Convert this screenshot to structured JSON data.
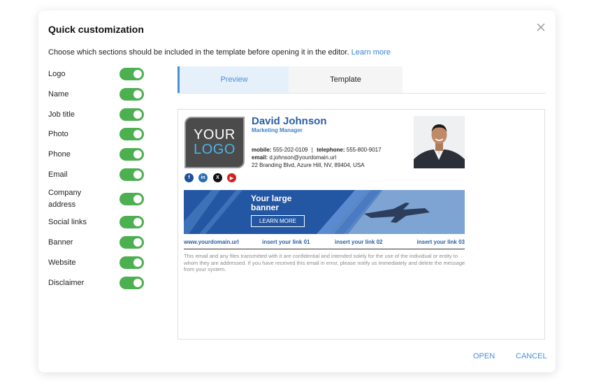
{
  "dialog": {
    "title": "Quick customization",
    "intro_text": "Choose which sections should be included in the template before opening it in the editor.",
    "learn_more": "Learn more"
  },
  "options": [
    {
      "label": "Logo",
      "enabled": true
    },
    {
      "label": "Name",
      "enabled": true
    },
    {
      "label": "Job title",
      "enabled": true
    },
    {
      "label": "Photo",
      "enabled": true
    },
    {
      "label": "Phone",
      "enabled": true
    },
    {
      "label": "Email",
      "enabled": true
    },
    {
      "label": "Company address",
      "enabled": true
    },
    {
      "label": "Social links",
      "enabled": true
    },
    {
      "label": "Banner",
      "enabled": true
    },
    {
      "label": "Website",
      "enabled": true
    },
    {
      "label": "Disclaimer",
      "enabled": true
    }
  ],
  "tabs": {
    "preview": "Preview",
    "template": "Template",
    "active": "preview"
  },
  "signature": {
    "logo_line1": "YOUR",
    "logo_line2": "LOGO",
    "name": "David Johnson",
    "job_title": "Marketing Manager",
    "mobile_label": "mobile:",
    "mobile": "555-202-0109",
    "separator": "|",
    "telephone_label": "telephone:",
    "telephone": "555-800-9017",
    "email_label": "email:",
    "email": "d.johnson@yourdomain.url",
    "address": "22 Branding Blvd, Azure Hill, NV, 89404, USA",
    "social": [
      "facebook-icon",
      "linkedin-icon",
      "x-icon",
      "youtube-icon"
    ],
    "banner_title_line1": "Your large",
    "banner_title_line2": "banner",
    "banner_button": "LEARN MORE",
    "links": [
      "www.yourdomain.url",
      "insert your link 01",
      "insert your link 02",
      "insert your link 03"
    ],
    "disclaimer": "This email and any files transmitted with it are confidential and intended solely for the use of the individual or entity to whom they are addressed. If you have received this email in error, please notify us immediately and delete the message from your system."
  },
  "actions": {
    "open": "OPEN",
    "cancel": "CANCEL"
  },
  "colors": {
    "accent": "#4a8fd8",
    "toggle_on": "#4caf50",
    "name_blue": "#2a5ea6",
    "banner_blue": "#2357a3"
  }
}
